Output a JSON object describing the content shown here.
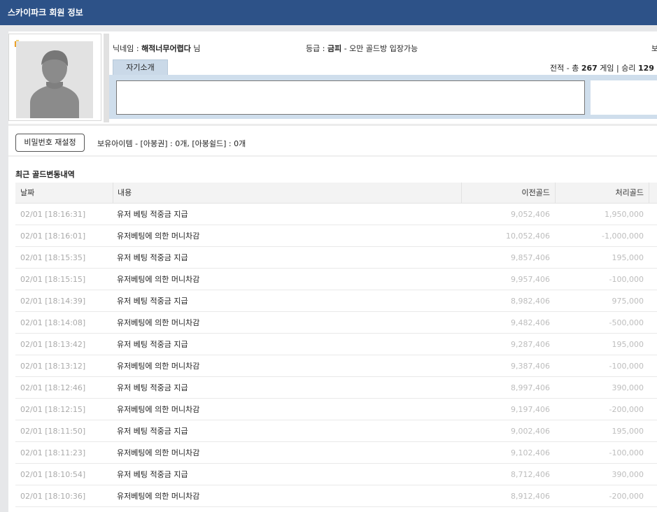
{
  "header": {
    "title": "스카이파크 회원 정보"
  },
  "profile": {
    "nickname_label": "닉네임 : ",
    "nickname": "해적너무어렵다",
    "nickname_suffix": " 님",
    "grade_label": "등급 : ",
    "grade": "금피",
    "grade_suffix": " - 오만 골드방 입장가능",
    "right_cut_text": "보",
    "tab_label": "자기소개",
    "stats_prefix": "전적 - 총 ",
    "stats_total": "267",
    "stats_middle": " 게임 | 승리 ",
    "stats_wins": "129"
  },
  "actions": {
    "password_button": "비밀번호 재설정",
    "items_text": "보유아이템 - [아봉권] : 0개, [아봉쉴드] : 0개"
  },
  "section": {
    "title": "최근 골드변동내역"
  },
  "table": {
    "headers": [
      "날짜",
      "내용",
      "이전골드",
      "처리골드",
      ""
    ],
    "rows": [
      [
        "02/01 [18:16:31]",
        "유저 베팅 적중금 지급",
        "9,052,406",
        "1,950,000"
      ],
      [
        "02/01 [18:16:01]",
        "유저베팅에 의한 머니차감",
        "10,052,406",
        "-1,000,000"
      ],
      [
        "02/01 [18:15:35]",
        "유저 베팅 적중금 지급",
        "9,857,406",
        "195,000"
      ],
      [
        "02/01 [18:15:15]",
        "유저베팅에 의한 머니차감",
        "9,957,406",
        "-100,000"
      ],
      [
        "02/01 [18:14:39]",
        "유저 베팅 적중금 지급",
        "8,982,406",
        "975,000"
      ],
      [
        "02/01 [18:14:08]",
        "유저베팅에 의한 머니차감",
        "9,482,406",
        "-500,000"
      ],
      [
        "02/01 [18:13:42]",
        "유저 베팅 적중금 지급",
        "9,287,406",
        "195,000"
      ],
      [
        "02/01 [18:13:12]",
        "유저베팅에 의한 머니차감",
        "9,387,406",
        "-100,000"
      ],
      [
        "02/01 [18:12:46]",
        "유저 베팅 적중금 지급",
        "8,997,406",
        "390,000"
      ],
      [
        "02/01 [18:12:15]",
        "유저베팅에 의한 머니차감",
        "9,197,406",
        "-200,000"
      ],
      [
        "02/01 [18:11:50]",
        "유저 베팅 적중금 지급",
        "9,002,406",
        "195,000"
      ],
      [
        "02/01 [18:11:23]",
        "유저베팅에 의한 머니차감",
        "9,102,406",
        "-100,000"
      ],
      [
        "02/01 [18:10:54]",
        "유저 베팅 적중금 지급",
        "8,712,406",
        "390,000"
      ],
      [
        "02/01 [18:10:36]",
        "유저베팅에 의한 머니차감",
        "8,912,406",
        "-200,000"
      ]
    ]
  }
}
